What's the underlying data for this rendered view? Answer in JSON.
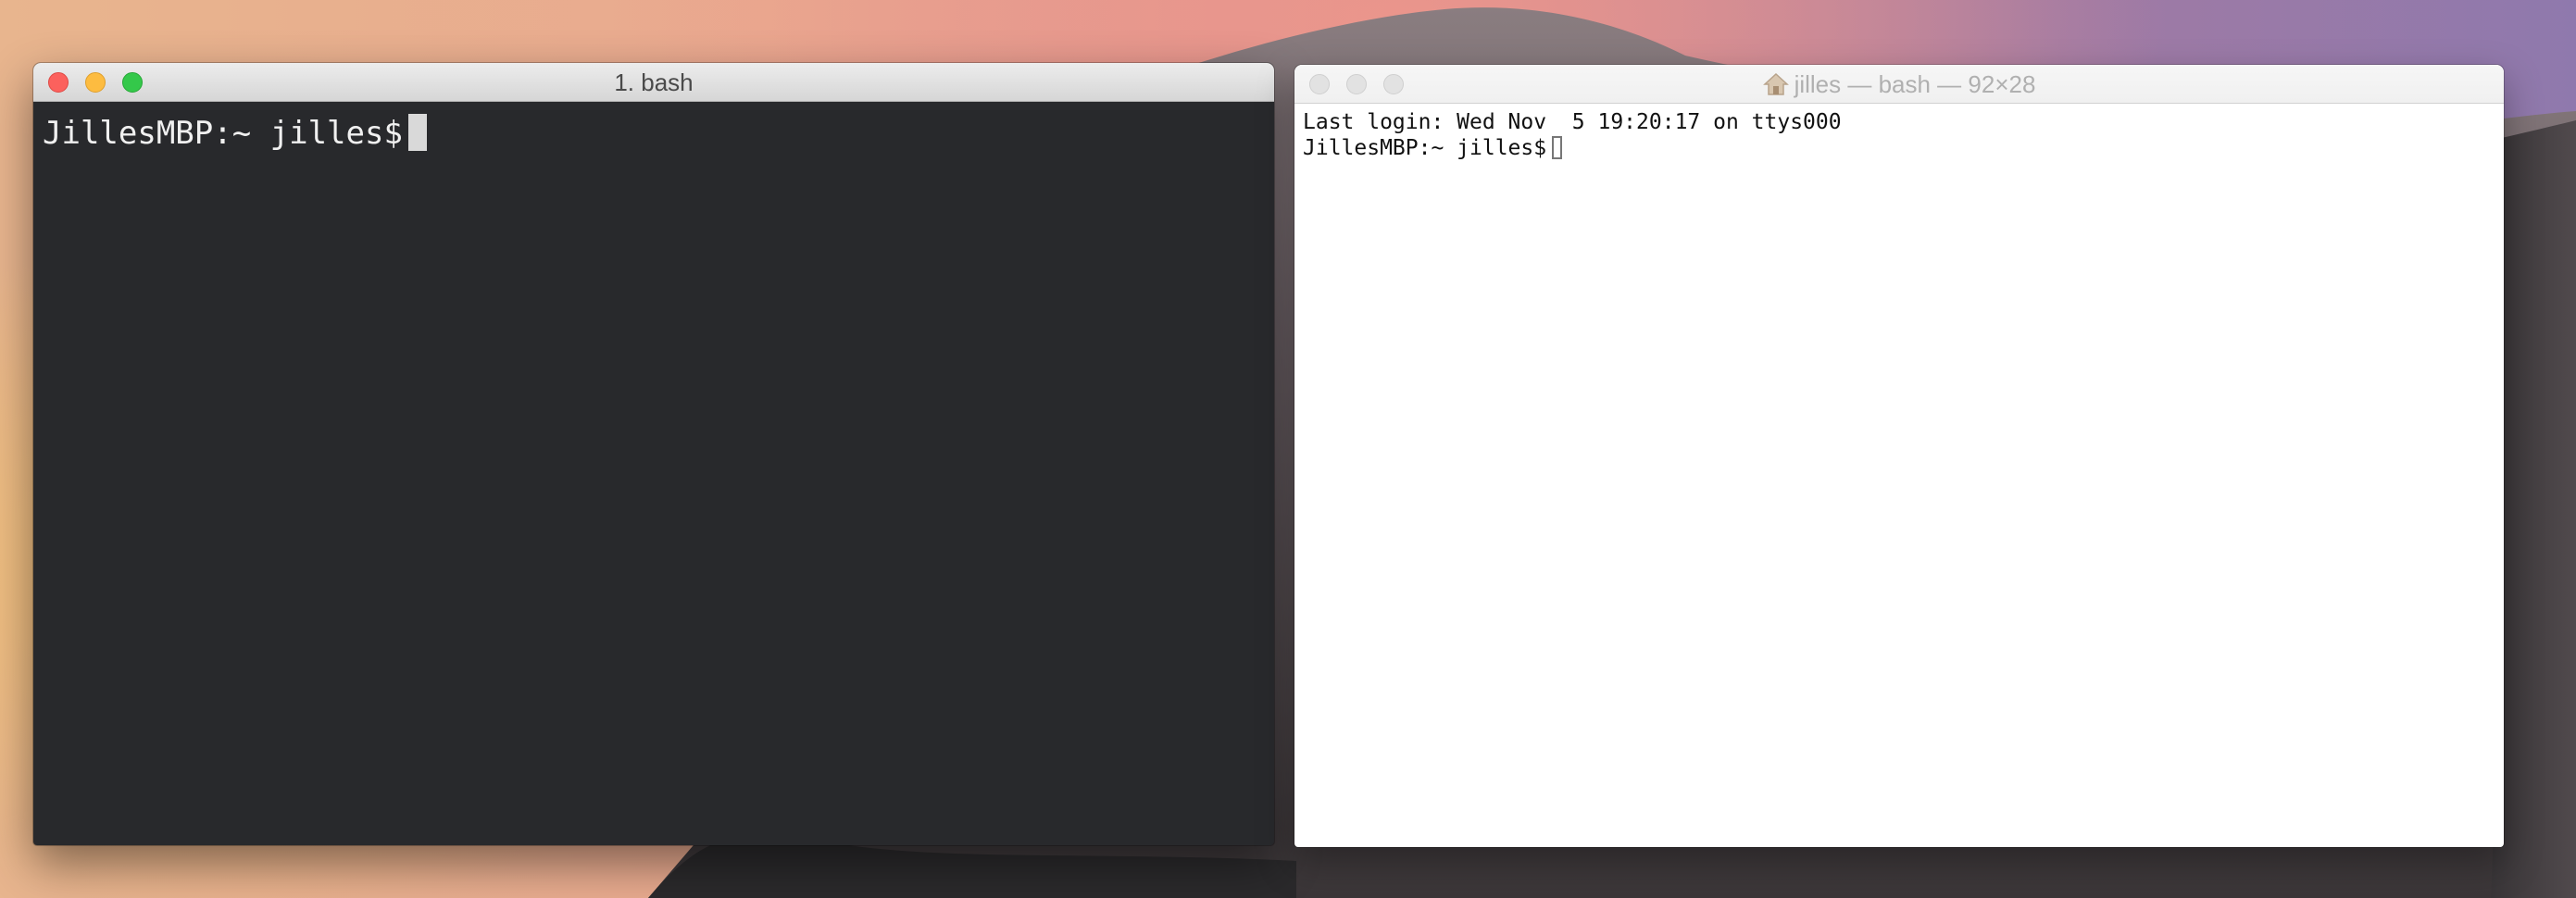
{
  "windows": {
    "left": {
      "title": "1. bash",
      "focused": true,
      "theme": "dark",
      "background": "#28292c",
      "lines": [
        {
          "prompt": "JillesMBP:~ jilles$"
        }
      ]
    },
    "right": {
      "title": "jilles — bash — 92×28",
      "title_icon": "home-icon",
      "focused": false,
      "theme": "light",
      "background": "#ffffff",
      "lines": [
        {
          "text": "Last login: Wed Nov  5 19:20:17 on ttys000"
        },
        {
          "prompt": "JillesMBP:~ jilles$"
        }
      ]
    }
  },
  "colors": {
    "close": "#fc615d",
    "minimize": "#fdbc40",
    "zoom": "#34c84a"
  }
}
